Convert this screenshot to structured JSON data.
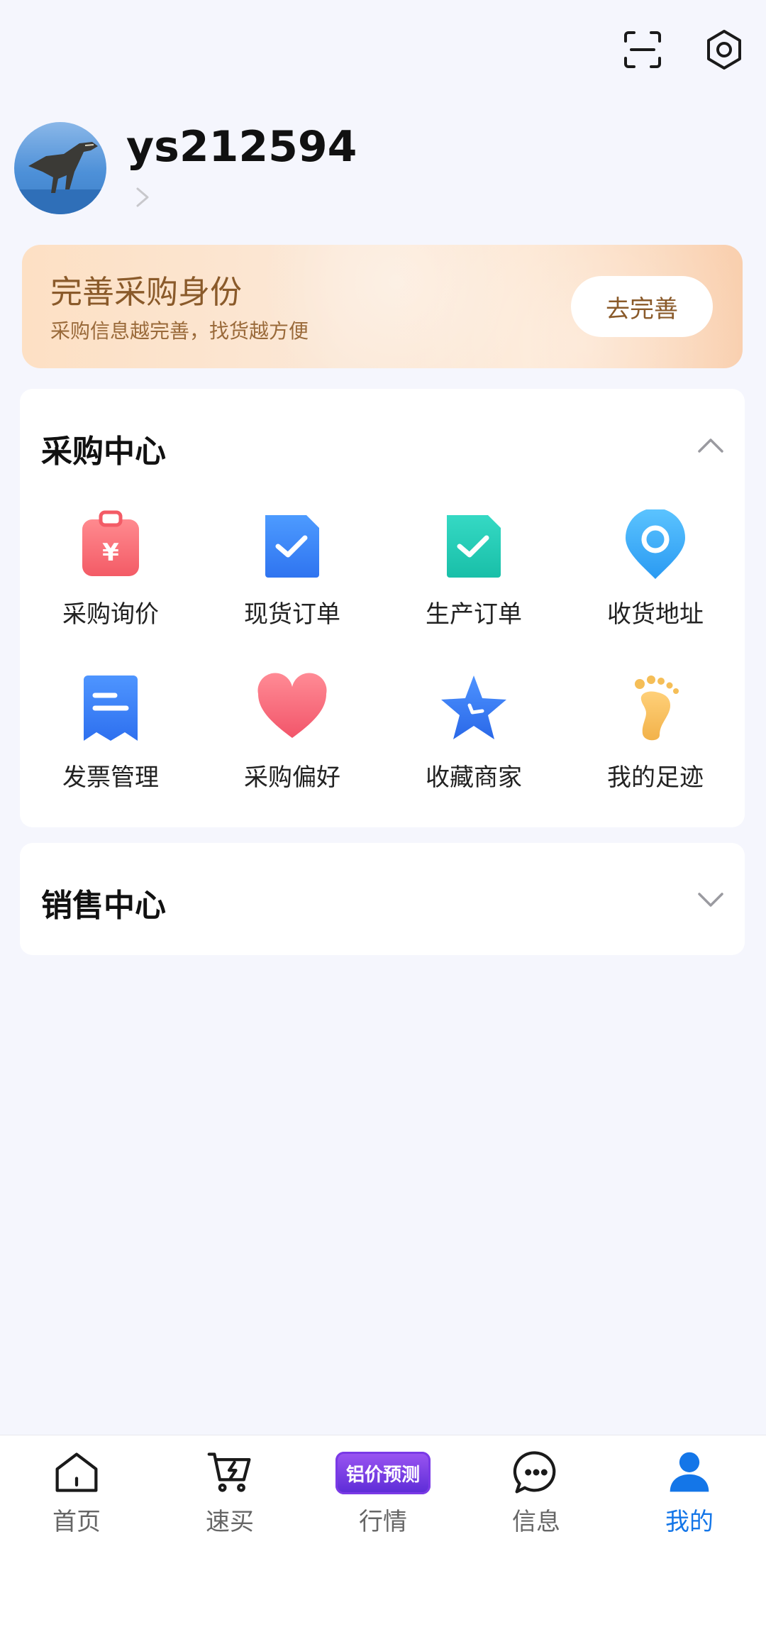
{
  "header": {
    "scan_icon": "scan-icon",
    "settings_icon": "settings-hexagon-icon"
  },
  "profile": {
    "username": "ys212594",
    "avatar_icon": "dinosaur-avatar"
  },
  "banner": {
    "title": "完善采购身份",
    "subtitle": "采购信息越完善，找货越方便",
    "button_label": "去完善"
  },
  "purchase_center": {
    "title": "采购中心",
    "expanded": true,
    "items": [
      {
        "label": "采购询价",
        "icon": "clipboard-yen-icon"
      },
      {
        "label": "现货订单",
        "icon": "doc-check-blue-icon"
      },
      {
        "label": "生产订单",
        "icon": "doc-check-green-icon"
      },
      {
        "label": "收货地址",
        "icon": "location-pin-icon"
      },
      {
        "label": "发票管理",
        "icon": "invoice-icon"
      },
      {
        "label": "采购偏好",
        "icon": "heart-icon"
      },
      {
        "label": "收藏商家",
        "icon": "star-icon"
      },
      {
        "label": "我的足迹",
        "icon": "footprint-icon"
      }
    ]
  },
  "sales_center": {
    "title": "销售中心",
    "expanded": false
  },
  "bottom_nav": {
    "items": [
      {
        "label": "首页",
        "icon": "home-icon",
        "active": false
      },
      {
        "label": "速买",
        "icon": "quick-buy-cart-icon",
        "active": false
      },
      {
        "label": "行情",
        "badge": "铝价预测",
        "active": false
      },
      {
        "label": "信息",
        "icon": "chat-icon",
        "active": false
      },
      {
        "label": "我的",
        "icon": "person-icon",
        "active": true
      }
    ],
    "active_color": "#1476e8"
  }
}
